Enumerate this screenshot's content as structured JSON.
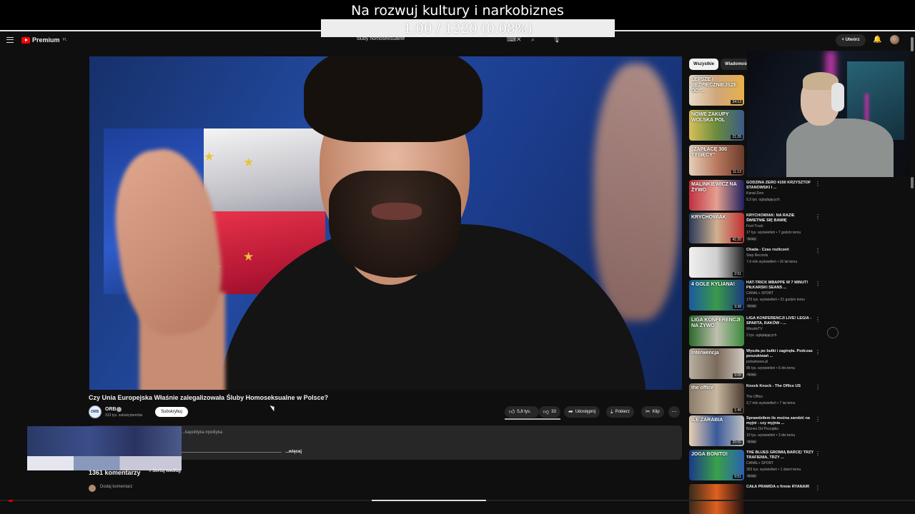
{
  "overlay": {
    "stream_title": "Na rozwuj kultury i narkobiznes",
    "counter": "1.00 / 1220 (0.08%)"
  },
  "header": {
    "logo": "Premium",
    "logo_country": "PL",
    "search_query": "śluby homoseksualne",
    "create_label": "Utwórz"
  },
  "video": {
    "title": "Czy Unia Europejska Właśnie zalegalizowała Śluby Homoseksualne w Polsce?",
    "channel": "ORB",
    "subscribers": "313 tys. subskrybentów",
    "subscribe_label": "Subskrybuj",
    "likes": "5,8 tys.",
    "dislikes": "33",
    "share_label": "Udostępnij",
    "download_label": "Pobierz",
    "clip_label": "Klip",
    "description_tags": "...kapolityka #polityka",
    "more_label": "...więcej",
    "comments_count": "1361 komentarzy",
    "sort_label": "Sortuj według",
    "add_comment_placeholder": "Dodaj komentarz"
  },
  "sidebar": {
    "chips": [
      "Wszystkie",
      "Wiadomości"
    ],
    "items": [
      {
        "title": "",
        "channel": "",
        "meta": "",
        "badge": "",
        "thumb_text": "LEPSZE I BEZPIECZNIEJSZE OD ...",
        "duration": "34:13"
      },
      {
        "title": "",
        "channel": "",
        "meta": "",
        "badge": "",
        "thumb_text": "NOWE ZAKUPY WOLSKA POL",
        "duration": "21:26"
      },
      {
        "title": "",
        "channel": "",
        "meta": "",
        "badge": "",
        "thumb_text": "\"ZAPŁACĘ 300 TYSIĘCY\"",
        "duration": "11:13"
      },
      {
        "title": "GODZINA ZERO #150 KRZYSZTOF STANOWSKI I ...",
        "channel": "Kanał Zero",
        "meta": "9,3 tys. oglądających",
        "badge": "",
        "thumb_text": "MALINKIEWICZ NA ŻYWO",
        "duration": ""
      },
      {
        "title": "KRYCHOWIAK: NA RAZIE ŚWIETNIE SIĘ BAWIĘ",
        "channel": "Foot Truck",
        "meta": "17 tys. wyświetleń • 7 godzin temu",
        "badge": "Nowy",
        "thumb_text": "KRYCHOWIAK",
        "duration": "41:20"
      },
      {
        "title": "Chada - Czas rozliczeń",
        "channel": "Step Records",
        "meta": "7,4 mln wyświetleń • 16 lat temu",
        "badge": "",
        "thumb_text": "",
        "duration": "2:51"
      },
      {
        "title": "HAT-TRICK MBAPPE W 7 MINUT! PIŁKARSKI SEANS ...",
        "channel": "CANAL+ SPORT",
        "meta": "170 tys. wyświetleń • 21 godzin temu",
        "badge": "Nowy",
        "thumb_text": "4 GOLE KYLIANA!",
        "duration": "9:38"
      },
      {
        "title": "LIGA KONFERENCJI LIVE! LEGIA - SPARTA, RAKÓW - ...",
        "channel": "WeszłoTV",
        "meta": "2 tys. oglądających",
        "badge": "",
        "thumb_text": "LIGA KONFERENCJI NA ŻYWO",
        "duration": ""
      },
      {
        "title": "Wyszła po bułki i zaginęła. Podczas poszukiwań ...",
        "channel": "polsatnews.pl",
        "meta": "86 tys. wyświetleń • 6 dni temu",
        "badge": "Nowy",
        "thumb_text": "Interwencja",
        "duration": "9:08"
      },
      {
        "title": "Knock Knock - The Office US",
        "channel": "The Office",
        "meta": "3,7 mln wyświetleń • 7 lat temu",
        "badge": "",
        "thumb_text": "the office",
        "duration": "1:46"
      },
      {
        "title": "Sprawdziłem ile można zarobić na myjni - czy myjnia ...",
        "channel": "Biznes Od Początku",
        "meta": "10 tys. wyświetleń • 3 dni temu",
        "badge": "Nowy",
        "thumb_text": "ILE ZARABIA",
        "duration": "20:00"
      },
      {
        "title": "THE BLUES GROMIĄ BARCĘ! TRZY TRAFIENIA, TRZY ...",
        "channel": "CANAL+ SPORT",
        "meta": "353 tys. wyświetleń • 1 dzień temu",
        "badge": "Nowy",
        "thumb_text": "JOGA BONITO!",
        "duration": "9:51"
      },
      {
        "title": "CAŁA PRAWDA o firmie RYANAIR",
        "channel": "",
        "meta": "",
        "badge": "",
        "thumb_text": "",
        "duration": ""
      }
    ]
  }
}
